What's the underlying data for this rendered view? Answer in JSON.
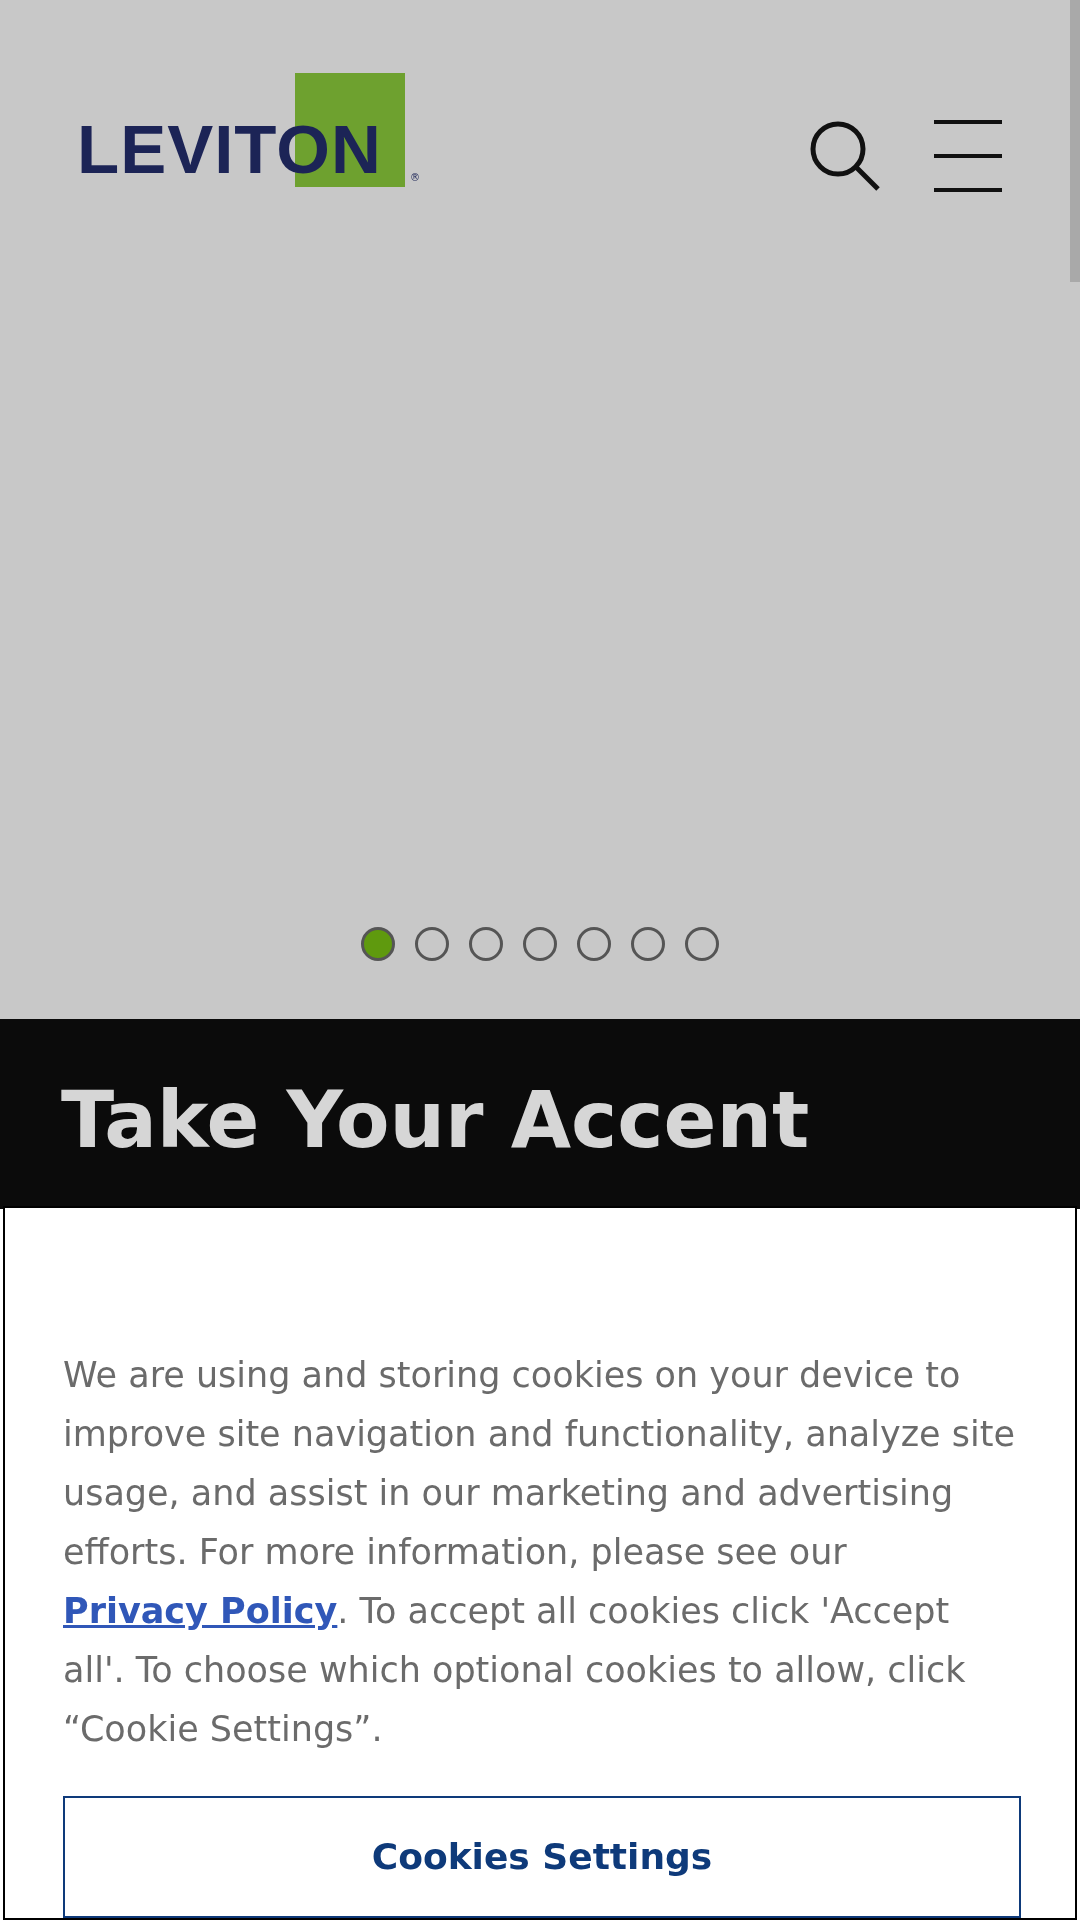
{
  "header": {
    "logo": {
      "text": "LEVITON",
      "mark": "®"
    }
  },
  "carousel": {
    "dots": [
      {
        "selected": true
      },
      {
        "selected": false
      },
      {
        "selected": false
      },
      {
        "selected": false
      },
      {
        "selected": false
      },
      {
        "selected": false
      },
      {
        "selected": false
      }
    ]
  },
  "banner": {
    "title": "Take Your Accent"
  },
  "cookie_notice": {
    "text_before": "We are using and storing cookies on your device to improve site navigation and functionality, analyze site usage, and assist in our marketing and advertising efforts. For more information, please see our ",
    "link": "Privacy Policy",
    "text_after": ". To accept all cookies click 'Accept all'.  To choose which optional cookies to allow, click “Cookie Settings”.",
    "button": "Cookies Settings"
  }
}
